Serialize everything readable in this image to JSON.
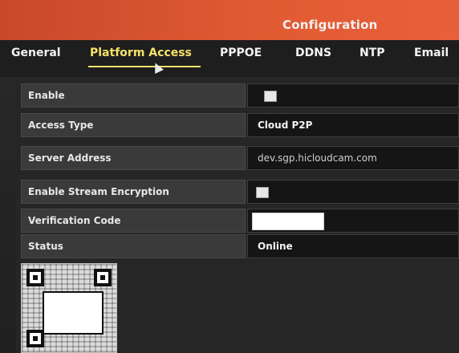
{
  "window": {
    "title": "Configuration"
  },
  "tabs": [
    {
      "label": "General",
      "active": false
    },
    {
      "label": "Platform Access",
      "active": true
    },
    {
      "label": "PPPOE",
      "active": false
    },
    {
      "label": "DDNS",
      "active": false
    },
    {
      "label": "NTP",
      "active": false
    },
    {
      "label": "Email",
      "active": false
    }
  ],
  "form": {
    "enable": {
      "label": "Enable",
      "checked": true
    },
    "access_type": {
      "label": "Access Type",
      "value": "Cloud P2P"
    },
    "server_address": {
      "label": "Server Address",
      "value": "dev.sgp.hicloudcam.com"
    },
    "enable_stream_encryption": {
      "label": "Enable Stream Encryption",
      "checked": false
    },
    "verification_code": {
      "label": "Verification Code",
      "value": ""
    },
    "status": {
      "label": "Status",
      "value": "Online"
    }
  },
  "colors": {
    "title_bar": "#e05a32",
    "active_tab": "#f7e26a"
  },
  "icons": {
    "cursor": "mouse-cursor-icon",
    "qr": "qr-code-icon"
  }
}
